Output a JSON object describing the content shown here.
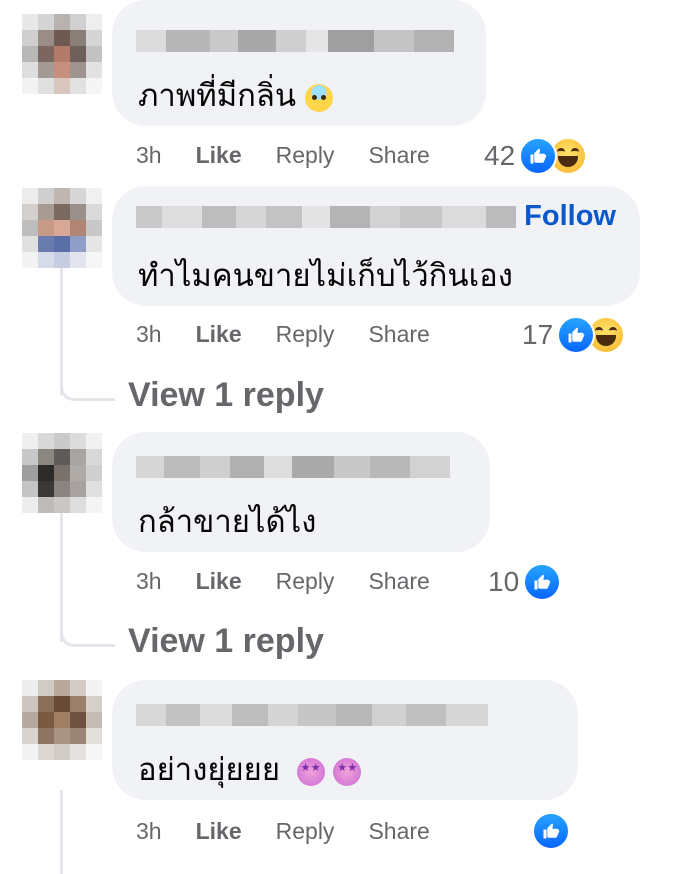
{
  "comments": [
    {
      "text": "ภาพที่มีกลิ่น",
      "emoji": "anxious-face-icon",
      "time": "3h",
      "like": "Like",
      "reply": "Reply",
      "share": "Share",
      "react_count": "42",
      "reactions": [
        "like",
        "haha"
      ]
    },
    {
      "text": "ทำไมคนขายไม่เก็บไว้กินเอง",
      "follow": "Follow",
      "time": "3h",
      "like": "Like",
      "reply": "Reply",
      "share": "Share",
      "react_count": "17",
      "reactions": [
        "like",
        "haha"
      ],
      "view_replies": "View 1 reply"
    },
    {
      "text": "กล้าขายได้ไง",
      "time": "3h",
      "like": "Like",
      "reply": "Reply",
      "share": "Share",
      "react_count": "10",
      "reactions": [
        "like"
      ],
      "view_replies": "View 1 reply"
    },
    {
      "text": "อย่างยุ่ยยย",
      "emoji": "star-struck-face-icon",
      "time": "3h",
      "like": "Like",
      "reply": "Reply",
      "share": "Share",
      "react_count": "",
      "reactions": [
        "like"
      ]
    }
  ],
  "colors": {
    "bubble": "#f0f2f5",
    "link": "#0a58ca",
    "like_icon": "#0866ff",
    "muted": "#65676b"
  }
}
